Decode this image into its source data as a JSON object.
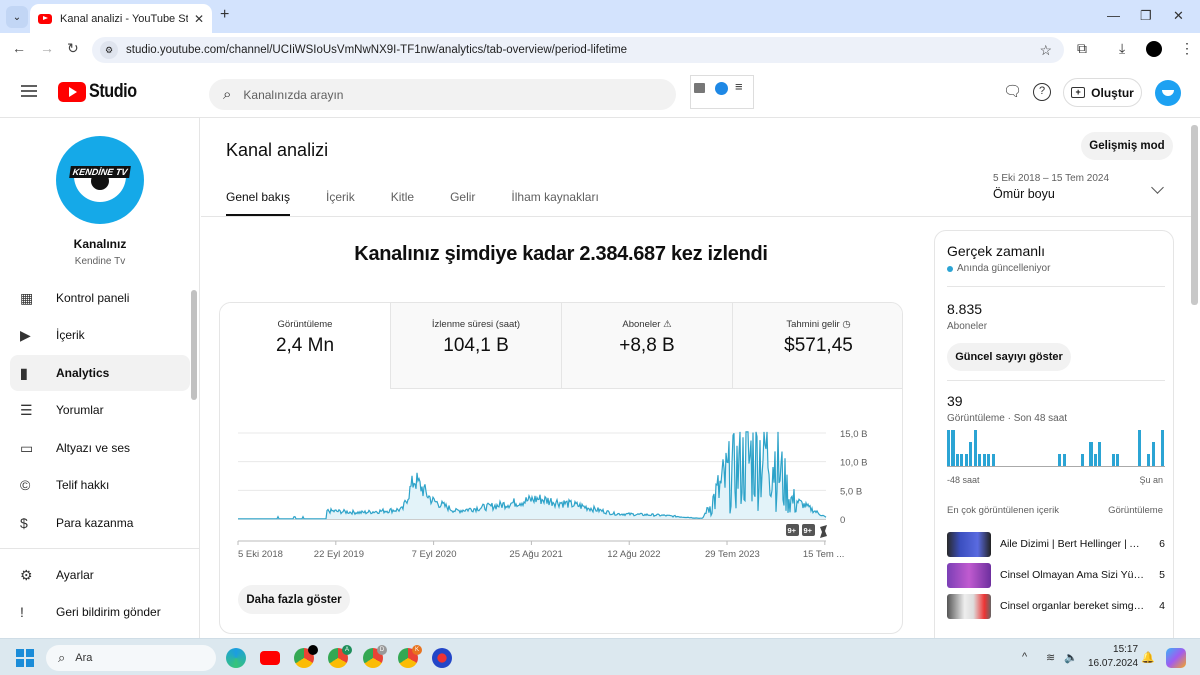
{
  "browser": {
    "tab_title": "Kanal analizi - YouTube Studio",
    "url": "studio.youtube.com/channel/UCIiWSIoUsVmNwNX9I-TF1nw/analytics/tab-overview/period-lifetime"
  },
  "header": {
    "logo_text": "Studio",
    "search_placeholder": "Kanalınızda arayın",
    "create_label": "Oluştur"
  },
  "sidebar": {
    "channel_title": "Kanalınız",
    "channel_name": "Kendine Tv",
    "channel_brand": "KENDİNE TV",
    "items": [
      {
        "label": "Kontrol paneli",
        "icon": "dashboard-icon",
        "glyph": "▦"
      },
      {
        "label": "İçerik",
        "icon": "content-icon",
        "glyph": "▶"
      },
      {
        "label": "Analytics",
        "icon": "analytics-icon",
        "glyph": "▮",
        "active": true
      },
      {
        "label": "Yorumlar",
        "icon": "comments-icon",
        "glyph": "☰"
      },
      {
        "label": "Altyazı ve ses",
        "icon": "subtitles-icon",
        "glyph": "▭"
      },
      {
        "label": "Telif hakkı",
        "icon": "copyright-icon",
        "glyph": "©"
      },
      {
        "label": "Para kazanma",
        "icon": "monetization-icon",
        "glyph": "$"
      }
    ],
    "bottom_items": [
      {
        "label": "Ayarlar",
        "icon": "settings-icon",
        "glyph": "⚙"
      },
      {
        "label": "Geri bildirim gönder",
        "icon": "feedback-icon",
        "glyph": "!"
      }
    ]
  },
  "main": {
    "title": "Kanal analizi",
    "advanced_mode": "Gelişmiş mod",
    "tabs": [
      {
        "label": "Genel bakış",
        "active": true
      },
      {
        "label": "İçerik"
      },
      {
        "label": "Kitle"
      },
      {
        "label": "Gelir"
      },
      {
        "label": "İlham kaynakları"
      }
    ],
    "period_range": "5 Eki 2018 – 15 Tem 2024",
    "period_label": "Ömür boyu",
    "headline": "Kanalınız şimdiye kadar 2.384.687 kez izlendi",
    "metrics": [
      {
        "label": "Görüntüleme",
        "value": "2,4 Mn"
      },
      {
        "label": "İzlenme süresi (saat)",
        "value": "104,1 B"
      },
      {
        "label": "Aboneler",
        "value": "+8,8 B",
        "icon": "warning-icon"
      },
      {
        "label": "Tahmini gelir",
        "value": "$571,45",
        "icon": "clock-icon"
      }
    ],
    "show_more": "Daha fazla göster",
    "chart_badges": [
      "9+",
      "9+"
    ]
  },
  "chart_data": {
    "type": "area",
    "title": "Görüntüleme",
    "xlabel": "",
    "ylabel": "",
    "x_ticks": [
      "5 Eki 2018",
      "22 Eyl 2019",
      "7 Eyl 2020",
      "25 Ağu 2021",
      "12 Ağu 2022",
      "29 Tem 2023",
      "15 Tem ..."
    ],
    "y_ticks": [
      "0",
      "5,0 B",
      "10,0 B",
      "15,0 B"
    ],
    "ylim": [
      0,
      15000
    ],
    "color": "#2ea3c9",
    "grid": true,
    "approx_daily_views_by_period": [
      {
        "period": "2018-10 to 2019-05",
        "value": 50
      },
      {
        "period": "2019-06",
        "value": 1500
      },
      {
        "period": "2019-09",
        "value": 1200
      },
      {
        "period": "2020-02",
        "value": 1800
      },
      {
        "period": "2020-04",
        "value": 7500
      },
      {
        "period": "2020-06",
        "value": 3500
      },
      {
        "period": "2020-09",
        "value": 1500
      },
      {
        "period": "2021-01",
        "value": 2500
      },
      {
        "period": "2021-05",
        "value": 3800
      },
      {
        "period": "2021-09",
        "value": 2500
      },
      {
        "period": "2022-01",
        "value": 1000
      },
      {
        "period": "2022-08",
        "value": 700
      },
      {
        "period": "2023-01",
        "value": 100
      },
      {
        "period": "2023-06",
        "value": 8500
      },
      {
        "period": "2023-10",
        "value": 13000
      },
      {
        "period": "2023-12",
        "value": 15000
      },
      {
        "period": "2024-03",
        "value": 4000
      },
      {
        "period": "2024-07",
        "value": 300
      }
    ]
  },
  "realtime": {
    "title": "Gerçek zamanlı",
    "subtitle": "Anında güncelleniyor",
    "subscribers": "8.835",
    "subscribers_label": "Aboneler",
    "show_count": "Güncel sayıyı göster",
    "views": "39",
    "views_label": "Görüntüleme · Son 48 saat",
    "axis_start": "-48 saat",
    "axis_end": "Şu an",
    "hourly_views": [
      3,
      3,
      1,
      1,
      1,
      2,
      3,
      1,
      1,
      1,
      1,
      0,
      0,
      0,
      0,
      0,
      0,
      0,
      0,
      0,
      0,
      0,
      0,
      0,
      0,
      1,
      1,
      0,
      0,
      0,
      1,
      0,
      2,
      1,
      2,
      0,
      0,
      1,
      1,
      0,
      0,
      0,
      0,
      3,
      0,
      1,
      2,
      0,
      3
    ],
    "top_head_left": "En çok görüntülenen içerik",
    "top_head_right": "Görüntüleme",
    "top_content": [
      {
        "title": "Aile Dizimi | Bert Hellinger | Ai...",
        "views": "6"
      },
      {
        "title": "Cinsel Olmayan Ama Sizi Yük...",
        "views": "5"
      },
      {
        "title": "Cinsel organlar bereket simge...",
        "views": "4"
      }
    ]
  },
  "taskbar": {
    "search_placeholder": "Ara",
    "time": "15:17",
    "date": "16.07.2024"
  }
}
